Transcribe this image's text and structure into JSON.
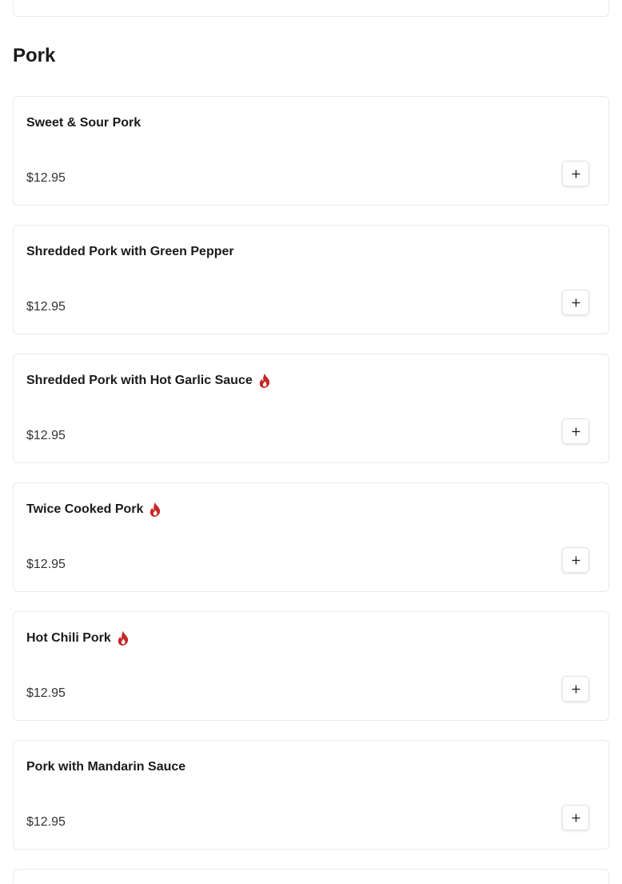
{
  "section": {
    "title": "Pork"
  },
  "colors": {
    "spicy": "#c62828",
    "price": "#333333",
    "border": "#e9e9e9"
  },
  "items": [
    {
      "name": "Sweet & Sour Pork",
      "price": "$12.95",
      "spicy": false
    },
    {
      "name": "Shredded Pork with Green Pepper",
      "price": "$12.95",
      "spicy": false
    },
    {
      "name": "Shredded Pork with Hot Garlic Sauce",
      "price": "$12.95",
      "spicy": true
    },
    {
      "name": "Twice Cooked Pork",
      "price": "$12.95",
      "spicy": true
    },
    {
      "name": "Hot Chili Pork",
      "price": "$12.95",
      "spicy": true
    },
    {
      "name": "Pork with Mandarin Sauce",
      "price": "$12.95",
      "spicy": false
    }
  ],
  "icons": {
    "spicy": "flame-icon",
    "add": "plus-icon"
  }
}
